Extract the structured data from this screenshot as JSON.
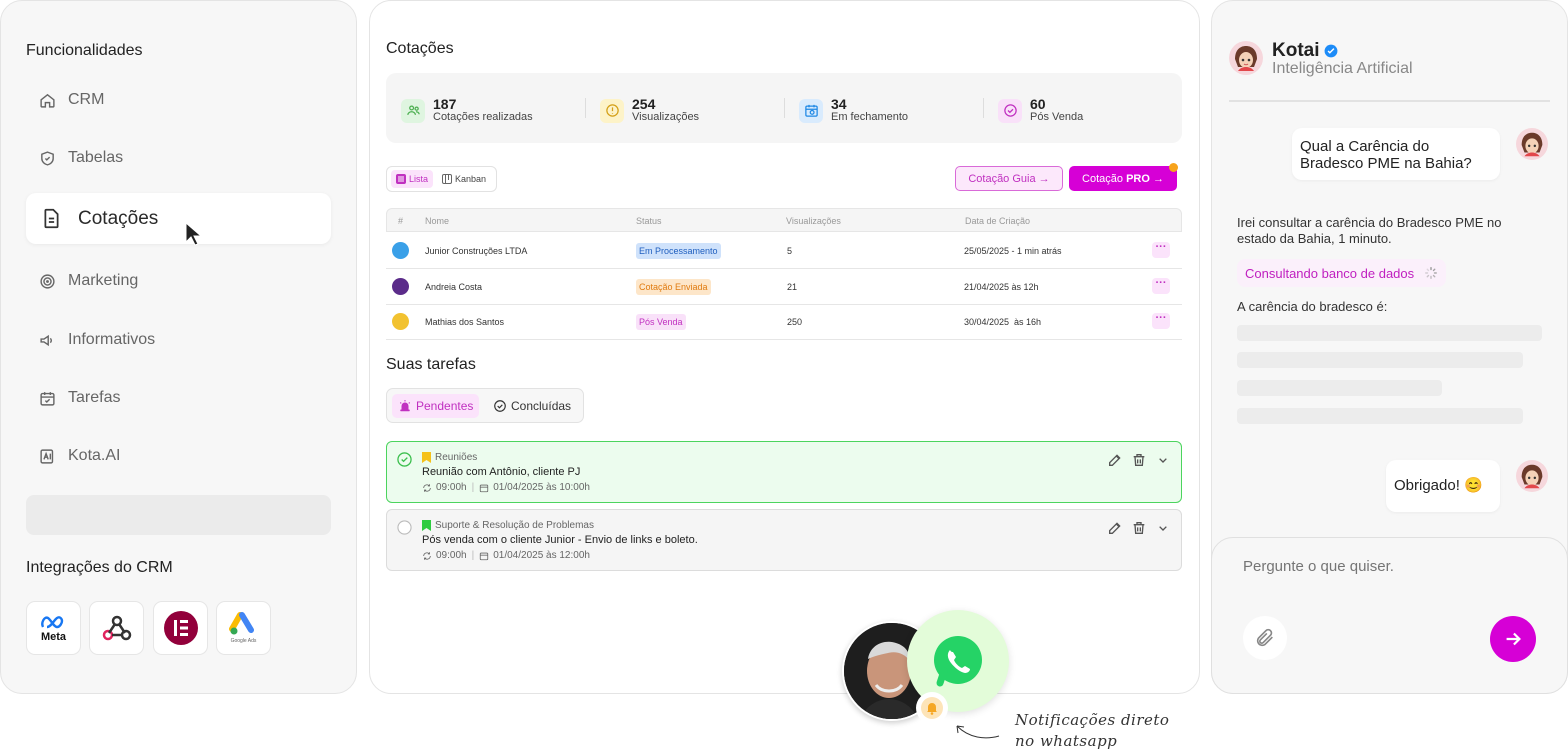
{
  "sidebar": {
    "title": "Funcionalidades",
    "items": [
      {
        "label": "CRM",
        "icon": "home-icon"
      },
      {
        "label": "Tabelas",
        "icon": "shield-icon"
      },
      {
        "label": "Cotações",
        "icon": "document-icon",
        "active": true
      },
      {
        "label": "Marketing",
        "icon": "target-icon"
      },
      {
        "label": "Informativos",
        "icon": "megaphone-icon"
      },
      {
        "label": "Tarefas",
        "icon": "calendar-icon"
      },
      {
        "label": "Kota.AI",
        "icon": "ai-icon"
      }
    ],
    "integrations_title": "Integrações do CRM",
    "integrations": [
      {
        "name": "Meta",
        "icon": "meta-icon"
      },
      {
        "name": "",
        "icon": "webhook-icon"
      },
      {
        "name": "",
        "icon": "elementor-icon"
      },
      {
        "name": "Google Ads",
        "icon": "google-ads-icon"
      }
    ]
  },
  "main": {
    "title": "Cotações",
    "stats": [
      {
        "value": "187",
        "label": "Cotações realizadas",
        "color": "#4caf50",
        "bg": "#dff5e0",
        "icon": "users-icon"
      },
      {
        "value": "254",
        "label": "Visualizações",
        "color": "#d4a017",
        "bg": "#fdf3c8",
        "icon": "alert-icon"
      },
      {
        "value": "34",
        "label": "Em fechamento",
        "color": "#1e88e5",
        "bg": "#d9ebfd",
        "icon": "calendar-clock-icon"
      },
      {
        "value": "60",
        "label": "Pós Venda",
        "color": "#c030c0",
        "bg": "#f9e1f9",
        "icon": "check-circle-icon"
      }
    ],
    "view_toggle": {
      "list": "Lista",
      "kanban": "Kanban"
    },
    "buttons": {
      "guia": "Cotação Guia →",
      "pro_prefix": "Cotação ",
      "pro_bold": "PRO",
      "pro_suffix": " →"
    },
    "table": {
      "headers": [
        "#",
        "Nome",
        "Status",
        "Visualizações",
        "Data de Criação"
      ],
      "rows": [
        {
          "name": "Junior Construções LTDA",
          "status": "Em Processamento",
          "status_fg": "#1f5fbf",
          "status_bg": "#cfe2fb",
          "views": "5",
          "date": "25/05/2025 - 1 min atrás",
          "avatar": "#3aa0e8"
        },
        {
          "name": "Andreia Costa",
          "status": "Cotação Enviada",
          "status_fg": "#e07b10",
          "status_bg": "#fde6c9",
          "views": "21",
          "date": "21/04/2025 às 12h",
          "avatar": "#5b2c8a"
        },
        {
          "name": "Mathias dos Santos",
          "status": "Pós Venda",
          "status_fg": "#c030c0",
          "status_bg": "#f9e1f9",
          "views": "250",
          "date": "30/04/2025  às 16h",
          "avatar": "#f2c230"
        }
      ],
      "more_label": "···"
    },
    "tasks": {
      "title": "Suas tarefas",
      "tab_pending": "Pendentes",
      "tab_done": "Concluídas",
      "items": [
        {
          "category": "Reuniões",
          "title": "Reunião com Antônio, cliente PJ",
          "time": "09:00h",
          "date": "01/04/2025 às 10:00h",
          "done": true
        },
        {
          "category": "Suporte & Resolução de Problemas",
          "title": "Pós venda com o cliente Junior - Envio de links e boleto.",
          "time": "09:00h",
          "date": "01/04/2025 às 12:00h",
          "done": false
        }
      ]
    },
    "notification": {
      "line1": "Notificações direto",
      "line2": "no whatsapp"
    }
  },
  "chat": {
    "name": "Kotai",
    "subtitle": "Inteligência Artificial",
    "user_msg_1": "Qual a Carência do Bradesco PME na Bahia?",
    "ai_msg_1": "Irei consultar a carência do Bradesco PME no estado da Bahia, 1 minuto.",
    "consulting": "Consultando banco de dados",
    "ai_msg_2": "A carência do bradesco é:",
    "user_msg_2": "Obrigado! 😊",
    "input_placeholder": "Pergunte o que quiser.",
    "accent": "#d600d6"
  }
}
